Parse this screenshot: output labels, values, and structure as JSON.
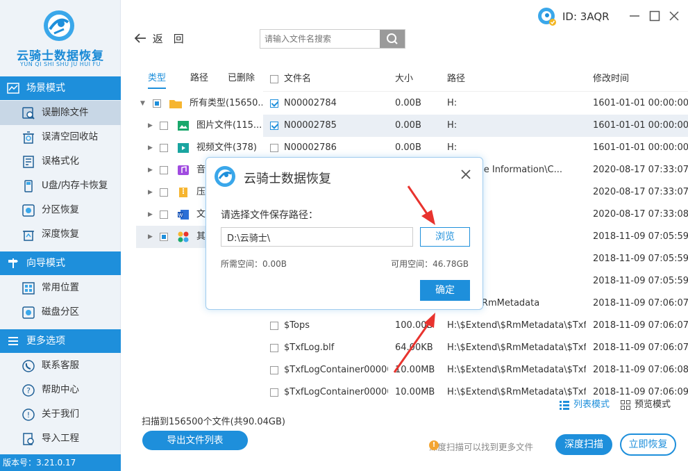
{
  "app": {
    "logo_title": "云骑士数据恢复",
    "logo_sub": "YUN QI SHI SHU JU HUI FU",
    "version": "版本号：3.21.0.17",
    "user_id": "ID: 3AQR"
  },
  "sidebar": {
    "sections": [
      {
        "title": "场景模式",
        "items": [
          "误删除文件",
          "误清空回收站",
          "误格式化",
          "U盘/内存卡恢复",
          "分区恢复",
          "深度恢复"
        ]
      },
      {
        "title": "向导模式",
        "items": [
          "常用位置",
          "磁盘分区"
        ]
      },
      {
        "title": "更多选项",
        "items": [
          "联系客服",
          "帮助中心",
          "关于我们",
          "导入工程"
        ]
      }
    ]
  },
  "toolbar": {
    "back_label": "返　回",
    "search_placeholder": "请输入文件名搜索"
  },
  "tree": {
    "tabs": [
      "类型",
      "路径",
      "已删除"
    ],
    "rows": [
      {
        "label": "所有类型(15650...",
        "icon": "folder-icon"
      },
      {
        "label": "图片文件(115...",
        "icon": "image-icon"
      },
      {
        "label": "视频文件(378)",
        "icon": "video-icon"
      },
      {
        "label": "音",
        "icon": "music-icon"
      },
      {
        "label": "压",
        "icon": "archive-icon"
      },
      {
        "label": "文",
        "icon": "document-icon"
      },
      {
        "label": "其",
        "icon": "other-icon"
      }
    ]
  },
  "table": {
    "headers": [
      "文件名",
      "大小",
      "路径",
      "修改时间"
    ],
    "rows": [
      {
        "name": "N00002784",
        "size": "0.00B",
        "path": "H:",
        "time": "1601-01-01 00:00:00",
        "checked": true
      },
      {
        "name": "N00002785",
        "size": "0.00B",
        "path": "H:",
        "time": "1601-01-01 00:00:00",
        "checked": true
      },
      {
        "name": "N00002786",
        "size": "0.00B",
        "path": "H:",
        "time": "1601-01-01 00:00:00",
        "checked": false
      },
      {
        "name": "",
        "size": "",
        "path": "n Volume Information\\C...",
        "time": "2020-08-17 07:33:07",
        "checked": false
      },
      {
        "name": "",
        "size": "",
        "path": "",
        "time": "2020-08-17 07:33:07",
        "checked": false
      },
      {
        "name": "",
        "size": "",
        "path": "",
        "time": "2020-08-17 07:33:08",
        "checked": false
      },
      {
        "name": "",
        "size": "",
        "path": "end",
        "time": "2018-11-09 07:05:59",
        "checked": false
      },
      {
        "name": "",
        "size": "",
        "path": "end",
        "time": "2018-11-09 07:05:59",
        "checked": false
      },
      {
        "name": "",
        "size": "",
        "path": "end",
        "time": "2018-11-09 07:05:59",
        "checked": false
      },
      {
        "name": "",
        "size": "",
        "path": "xtend\\$RmMetadata",
        "time": "2018-11-09 07:06:07",
        "checked": false
      },
      {
        "name": "$Tops",
        "size": "100.00B",
        "path": "H:\\$Extend\\$RmMetadata\\$TxfL...",
        "time": "2018-11-09 07:06:07",
        "checked": false
      },
      {
        "name": "$TxfLog.blf",
        "size": "64.00KB",
        "path": "H:\\$Extend\\$RmMetadata\\$TxfL...",
        "time": "2018-11-09 07:06:07",
        "checked": false
      },
      {
        "name": "$TxfLogContainer00000...",
        "size": "10.00MB",
        "path": "H:\\$Extend\\$RmMetadata\\$TxfL...",
        "time": "2018-11-09 07:06:08",
        "checked": false
      },
      {
        "name": "$TxfLogContainer00000...",
        "size": "10.00MB",
        "path": "H:\\$Extend\\$RmMetadata\\$Txfl...",
        "time": "2018-11-09 07:06:09",
        "checked": false
      }
    ]
  },
  "footer": {
    "scanned": "扫描到156500个文件(共90.04GB)",
    "export_label": "导出文件列表",
    "list_mode": "列表模式",
    "preview_mode": "预览模式",
    "hint": "深度扫描可以找到更多文件",
    "deep_scan": "深度扫描",
    "recover": "立即恢复"
  },
  "dialog": {
    "title": "云骑士数据恢复",
    "prompt": "请选择文件保存路径：",
    "path_value": "D:\\云骑士\\",
    "browse": "浏览",
    "need_space": "所需空间：0.00B",
    "avail_space": "可用空间：46.78GB",
    "ok": "确定"
  },
  "colors": {
    "accent": "#1e8fdb",
    "arrow": "#e8332e"
  }
}
